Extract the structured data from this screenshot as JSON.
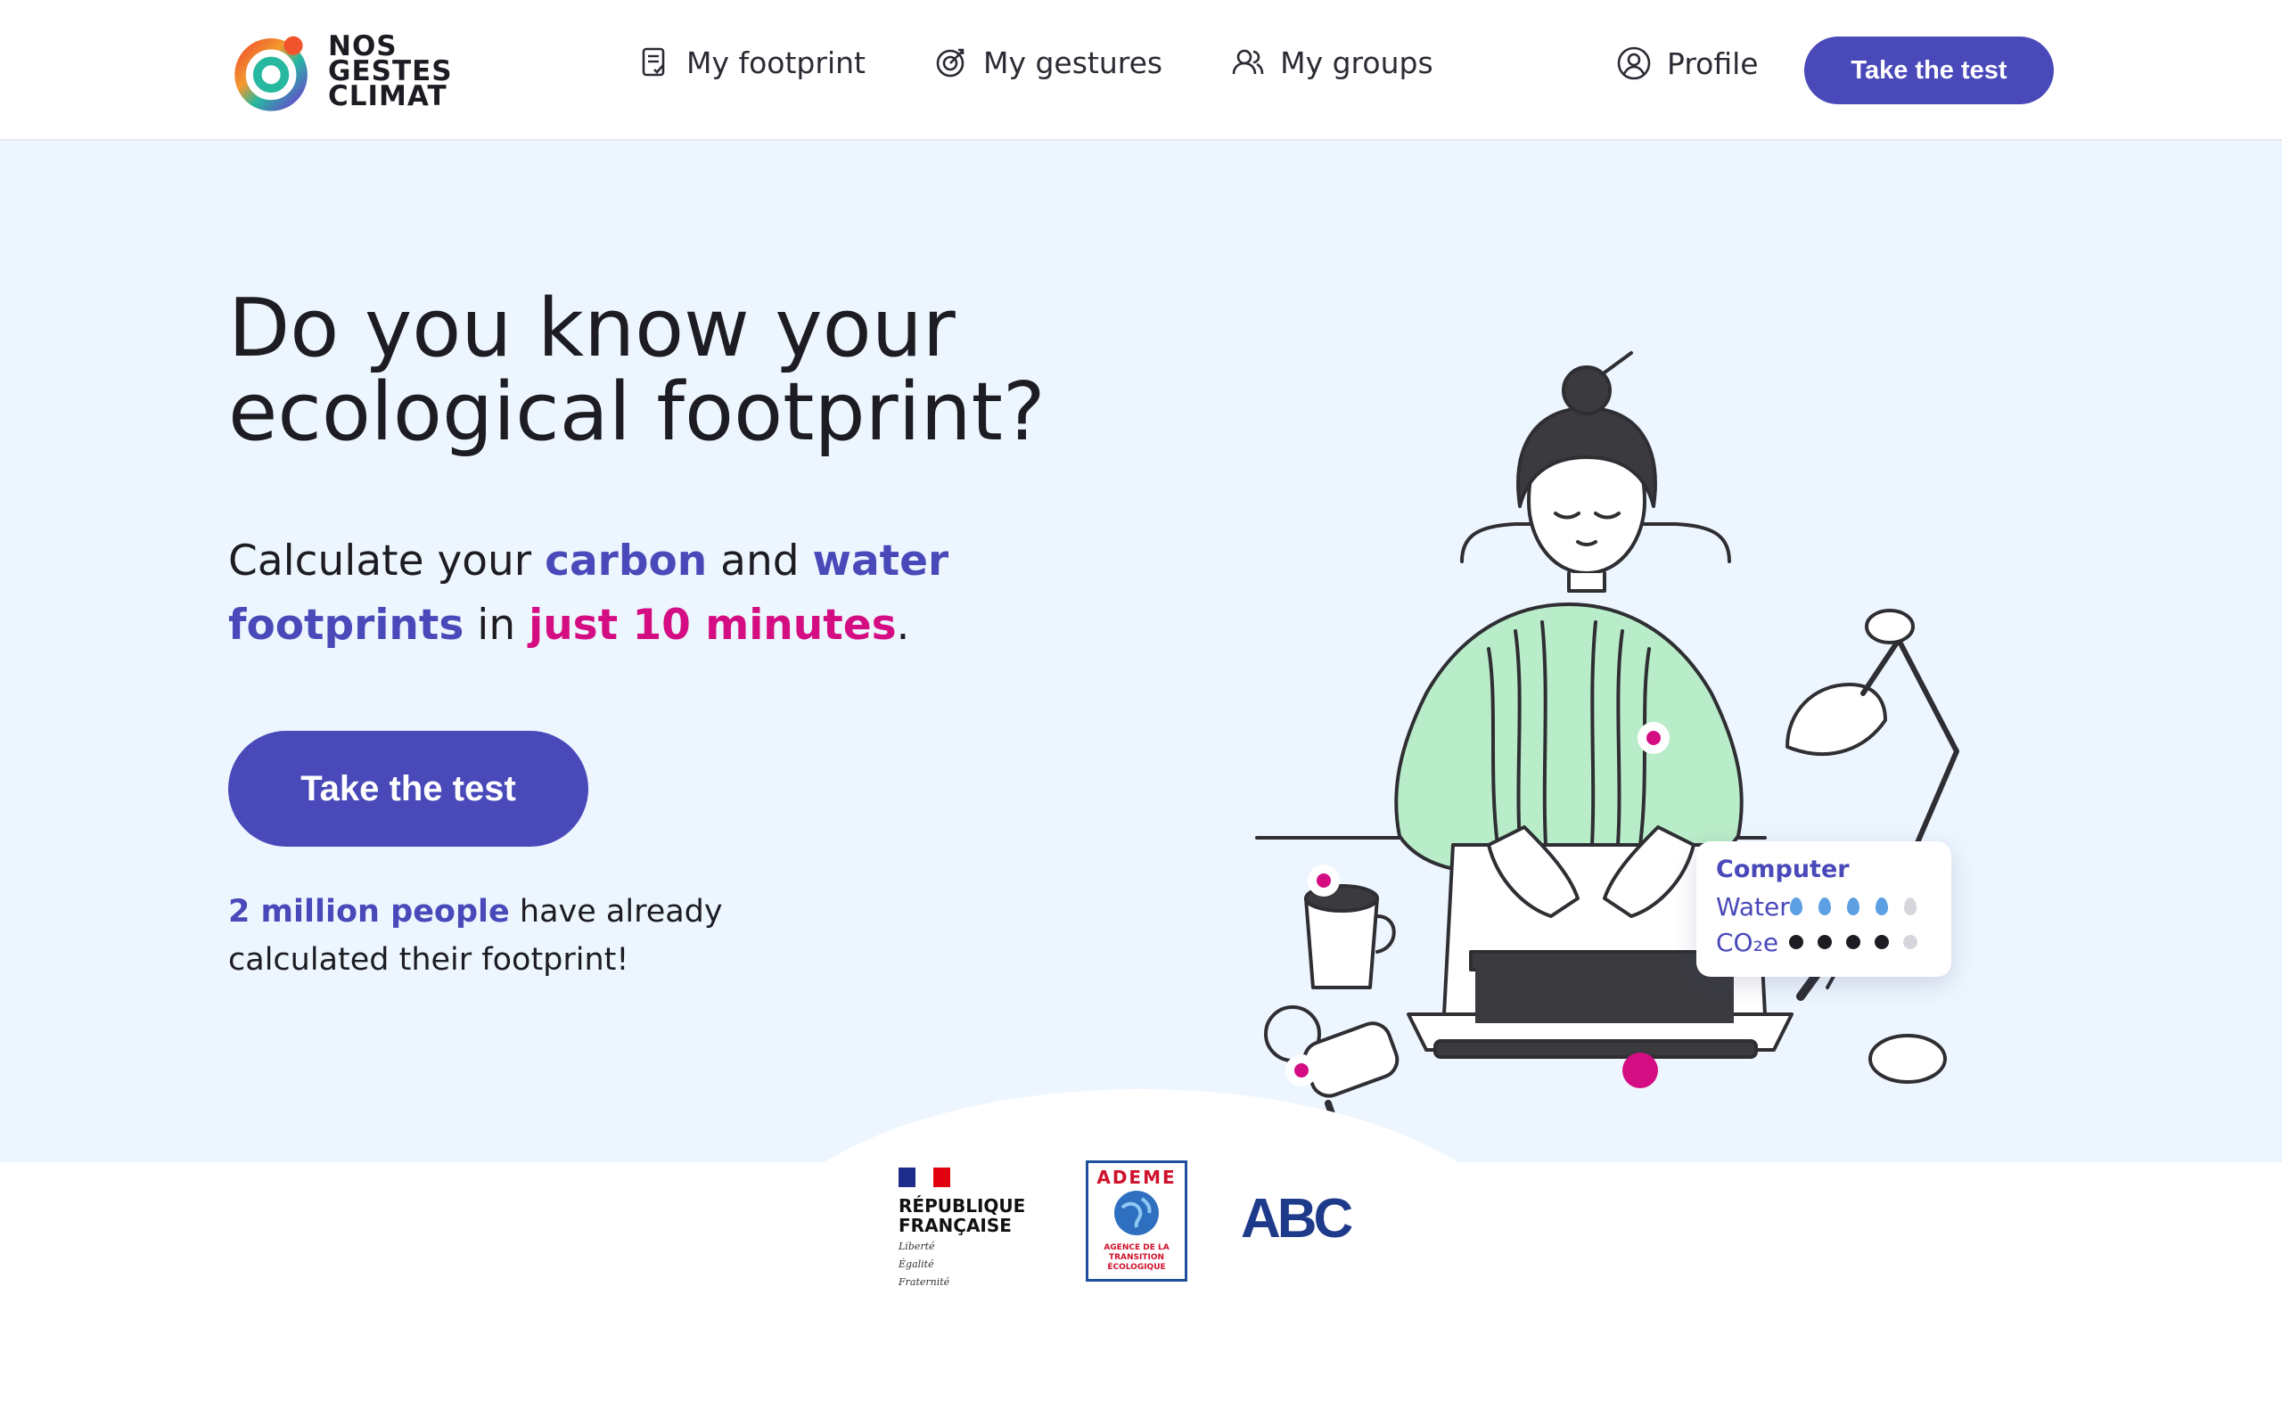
{
  "header": {
    "logo": {
      "line1": "NOS",
      "line2": "GESTES",
      "line3": "CLIMAT"
    },
    "nav": [
      {
        "label": "My footprint",
        "icon": "footprint-list-icon"
      },
      {
        "label": "My gestures",
        "icon": "target-icon"
      },
      {
        "label": "My groups",
        "icon": "group-icon"
      }
    ],
    "profile_label": "Profile",
    "cta_label": "Take the test"
  },
  "hero": {
    "title": "Do you know your ecological footprint?",
    "subtitle": {
      "p1": "Calculate your ",
      "carbon": "carbon",
      "p2": " and ",
      "water_footprints": "water footprints",
      "p3": " in ",
      "minutes": "just 10 minutes",
      "p4": "."
    },
    "cta_label": "Take the test",
    "note": {
      "highlight": "2 million people",
      "rest": " have already calculated their footprint!"
    }
  },
  "info_card": {
    "title": "Computer",
    "water_label": "Water",
    "co2_label": "CO₂e",
    "water_level": 4,
    "co2_level": 4,
    "max_level": 5
  },
  "partners": {
    "rf": {
      "line1": "RÉPUBLIQUE",
      "line2": "FRANÇAISE",
      "motto1": "Liberté",
      "motto2": "Égalité",
      "motto3": "Fraternité"
    },
    "ademe": {
      "name": "ADEME",
      "sub1": "AGENCE DE LA",
      "sub2": "TRANSITION",
      "sub3": "ÉCOLOGIQUE"
    },
    "abc": "ABC"
  },
  "colors": {
    "primary": "#4949ba",
    "accent": "#d40d83",
    "hero_bg": "#edf6fe",
    "sweater": "#b9ecc8",
    "water_drop": "#5d9fe3"
  }
}
